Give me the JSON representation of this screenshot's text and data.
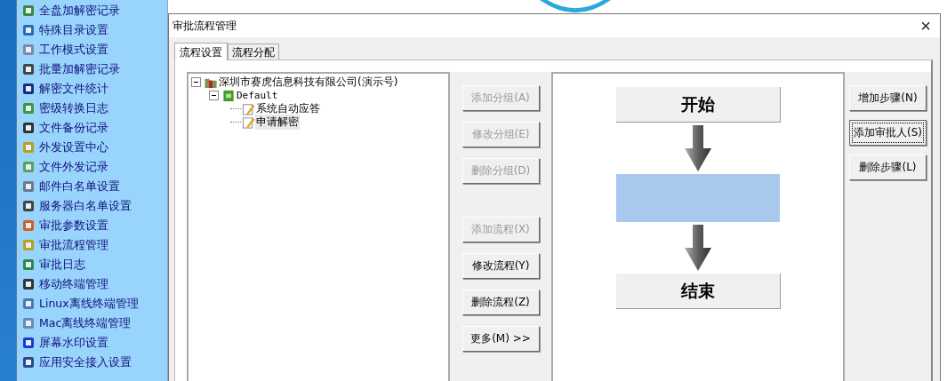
{
  "sidebar": {
    "items": [
      {
        "label": "全盘加解密记录",
        "selected": false
      },
      {
        "label": "特殊目录设置",
        "selected": false
      },
      {
        "label": "工作模式设置",
        "selected": false
      },
      {
        "label": "批量加解密记录",
        "selected": false
      },
      {
        "label": "解密文件统计",
        "selected": false
      },
      {
        "label": "密级转换日志",
        "selected": false
      },
      {
        "label": "文件备份记录",
        "selected": false
      },
      {
        "label": "外发设置中心",
        "selected": false
      },
      {
        "label": "文件外发记录",
        "selected": false
      },
      {
        "label": "邮件白名单设置",
        "selected": false
      },
      {
        "label": "服务器白名单设置",
        "selected": false
      },
      {
        "label": "审批参数设置",
        "selected": false
      },
      {
        "label": "审批流程管理",
        "selected": false
      },
      {
        "label": "审批日志",
        "selected": false
      },
      {
        "label": "移动终端管理",
        "selected": false
      },
      {
        "label": "Linux离线终端管理",
        "selected": false
      },
      {
        "label": "Mac离线终端管理",
        "selected": false
      },
      {
        "label": "屏幕水印设置",
        "selected": false
      },
      {
        "label": "应用安全接入设置",
        "selected": false
      }
    ]
  },
  "dialog": {
    "title": "审批流程管理",
    "close": "×",
    "tabs": [
      {
        "label": "流程设置",
        "selected": true
      },
      {
        "label": "流程分配",
        "selected": false
      }
    ],
    "tree": [
      {
        "label": "深圳市赛虎信息科技有限公司(演示号)",
        "expanded": true,
        "children": [
          {
            "label": "Default",
            "expanded": true,
            "children": [
              {
                "label": "系统自动应答",
                "selected": false
              },
              {
                "label": "申请解密",
                "selected": true
              }
            ]
          }
        ]
      }
    ],
    "group_buttons": [
      {
        "label": "添加分组(A)",
        "disabled": true
      },
      {
        "label": "修改分组(E)",
        "disabled": true
      },
      {
        "label": "删除分组(D)",
        "disabled": true
      }
    ],
    "flow_buttons": [
      {
        "label": "添加流程(X)",
        "disabled": true
      },
      {
        "label": "修改流程(Y)",
        "disabled": false
      },
      {
        "label": "删除流程(Z)",
        "disabled": false
      },
      {
        "label": "更多(M) >>",
        "disabled": false
      }
    ],
    "flow_steps": [
      {
        "kind": "start",
        "label": "开始"
      },
      {
        "kind": "approver",
        "selected": true
      },
      {
        "kind": "end",
        "label": "结束"
      }
    ],
    "step_buttons": [
      {
        "label": "增加步骤(N)",
        "focused": false
      },
      {
        "label": "添加审批人(S)",
        "focused": true
      },
      {
        "label": "删除步骤(L)",
        "focused": false
      }
    ]
  }
}
